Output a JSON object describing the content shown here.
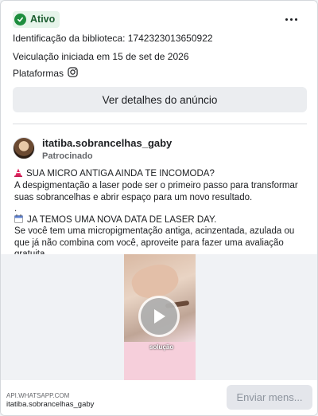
{
  "status": {
    "label": "Ativo",
    "color": "#1e8e3e"
  },
  "menu": {
    "icon": "more-horizontal-icon"
  },
  "meta": {
    "library_id": "Identificação da biblioteca: 1742323013650922",
    "started": "Veiculação iniciada em 15 de set de 2026",
    "platforms_label": "Plataformas",
    "platform_icon": "instagram-icon"
  },
  "details_button": "Ver detalhes do anúncio",
  "ad": {
    "page_name": "itatiba.sobrancelhas_gaby",
    "sponsored": "Patrocinado",
    "line1": "SUA MICRO ANTIGA AINDA TE INCOMODA?",
    "line2": "A despigmentação a laser pode ser o primeiro passo para transformar suas sobrancelhas e abrir espaço para um novo resultado.",
    "line3": ".",
    "line4": "JA TEMOS UMA NOVA DATA DE LASER DAY.",
    "line5": "Se você tem uma micropigmentação antiga, acinzentada, azulada ou que já não combina com você, aproveite para fazer uma avaliação gratuita...."
  },
  "video": {
    "caption": "solução",
    "play_icon": "play-icon"
  },
  "footer": {
    "domain": "API.WHATSAPP.COM",
    "name": "itatiba.sobrancelhas_gaby",
    "cta": "Enviar mens..."
  }
}
